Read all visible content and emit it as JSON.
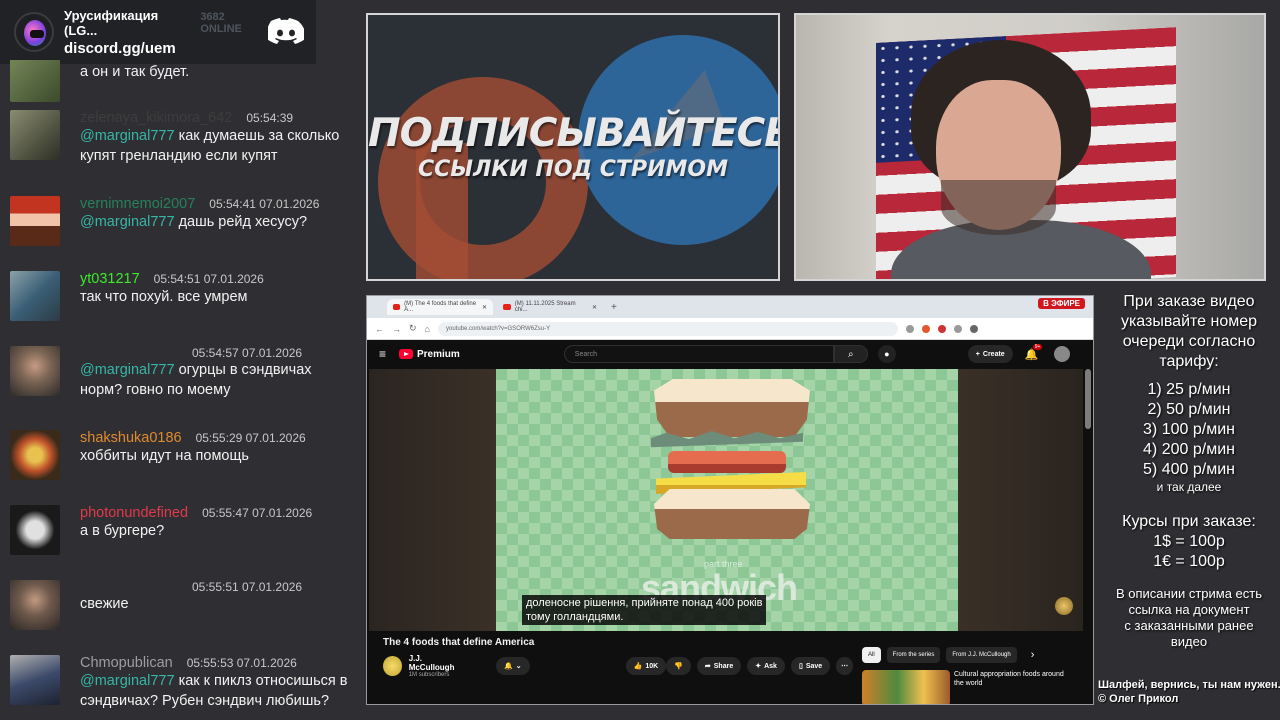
{
  "discord": {
    "server_name": "Урусификация (LG...",
    "online": "3682 ONLINE",
    "invite": "discord.gg/uem"
  },
  "chat": [
    {
      "nick": "",
      "time": "",
      "text": "а он и так будет.",
      "mention": "",
      "nick_color": "#cccccc",
      "avatar_colors": [
        "#7a8a5a",
        "#3b4b2c"
      ]
    },
    {
      "nick": "zelenaya_kikimora_642",
      "time": "05:54:39",
      "mention": "@marginal777",
      "text": "как думаешь за сколько купят гренландию если купят",
      "nick_color": "#3d3d3d",
      "avatar_colors": [
        "#4d5140",
        "#8a8c70"
      ]
    },
    {
      "nick": "vernimnemoi2007",
      "time": "05:54:41 07.01.2026",
      "mention": "@marginal777",
      "text": "дашь рейд хесусу?",
      "nick_color": "#26805c",
      "avatar_colors": [
        "#c23420",
        "#5a2a18"
      ]
    },
    {
      "nick": "yt031217",
      "time": "05:54:51 07.01.2026",
      "mention": "",
      "text": "так что похуй. все умрем",
      "nick_color": "#3ee82a",
      "avatar_colors": [
        "#3a5f76",
        "#8ba2a8"
      ]
    },
    {
      "nick": "",
      "time": "05:54:57 07.01.2026",
      "mention": "@marginal777",
      "text": "огурцы в сэндвичах норм? говно по моему",
      "nick_color": "#3d3d3d",
      "avatar_colors": [
        "#7b6554",
        "#2c2a2a"
      ]
    },
    {
      "nick": "shakshuka0186",
      "time": "05:55:29 07.01.2026",
      "mention": "",
      "text": "хоббиты идут на помощь",
      "nick_color": "#e08a2e",
      "avatar_colors": [
        "#c0522a",
        "#e8c24e"
      ]
    },
    {
      "nick": "photonundefined",
      "time": "05:55:47 07.01.2026",
      "mention": "",
      "text": "а в бургере?",
      "nick_color": "#e0394a",
      "avatar_colors": [
        "#e0e0e0",
        "#1a1a1a"
      ]
    },
    {
      "nick": "",
      "time": "05:55:51 07.01.2026",
      "mention": "",
      "text": "свежие",
      "nick_color": "#3d3d3d",
      "avatar_colors": [
        "#6f5a4c",
        "#2b2726"
      ]
    },
    {
      "nick": "Chmopublican",
      "time": "05:55:53 07.01.2026",
      "mention": "@marginal777",
      "text": "как к пиклз относишься в сэндвичах? Рубен сэндвич любишь?",
      "nick_color": "#9e9e9e",
      "avatar_colors": [
        "#3c4a6a",
        "#b0b0b0"
      ]
    }
  ],
  "promo": {
    "title": "ПОДПИСЫВАЙТЕСЬ",
    "subtitle": "ССЫЛКИ ПОД СТРИМОМ"
  },
  "browser": {
    "tabs": [
      "(M) The 4 foods that define A...",
      "(M) 11.11.2025 Stream chi..."
    ],
    "live_badge": "В ЭФИРЕ",
    "url": "youtube.com/watch?v=GSORW6Zsu-Y",
    "youtube": {
      "brand": "Premium",
      "search_placeholder": "Search",
      "create_label": "Create",
      "notif_count": "9+",
      "video_part": "part three",
      "video_word": "sandwich",
      "subtitle_line1": "доленосне рішення, прийняте понад 400 років",
      "subtitle_line2": "тому голландцями.",
      "video_title": "The 4 foods that define America",
      "channel_name": "J.J. McCullough",
      "channel_subs": "1M subscribers",
      "like_count": "10K",
      "share_label": "Share",
      "ask_label": "Ask",
      "save_label": "Save",
      "chips": [
        "All",
        "From the series",
        "From J.J. McCullough"
      ],
      "rec_title": "Cultural appropriation foods around the world"
    }
  },
  "info": {
    "head": [
      "При заказе видео",
      "указывайте номер",
      "очереди согласно",
      "тарифу:"
    ],
    "rates": [
      "1) 25 р/мин",
      "2) 50 р/мин",
      "3) 100 р/мин",
      "4) 200 р/мин",
      "5) 400 р/мин"
    ],
    "rates_more": "и так далее",
    "courses_head": "Курсы при заказе:",
    "courses": [
      "1$ = 100р",
      "1€ = 100р"
    ],
    "desc": [
      "В описании стрима есть",
      "ссылка на документ",
      "с заказанными ранее",
      "видео"
    ],
    "credits": [
      "Шалфей, вернись, ты нам нужен.",
      "© Олег Прикол"
    ]
  }
}
